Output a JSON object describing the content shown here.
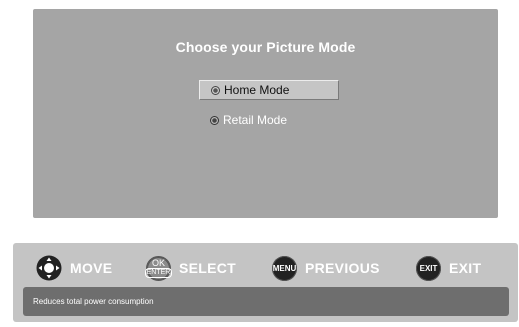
{
  "dialog": {
    "title": "Choose your Picture Mode",
    "options": [
      {
        "label": "Home Mode",
        "selected": true
      },
      {
        "label": "Retail Mode",
        "selected": false
      }
    ]
  },
  "footer": {
    "legend": [
      {
        "icon": "dpad-icon",
        "label": "MOVE"
      },
      {
        "icon": "ok-enter-icon",
        "button_top": "OK",
        "button_bottom": "ENTER",
        "label": "SELECT"
      },
      {
        "icon": "menu-button-icon",
        "button_text": "MENU",
        "label": "PREVIOUS"
      },
      {
        "icon": "exit-button-icon",
        "button_text": "EXIT",
        "label": "EXIT"
      }
    ],
    "help_text": "Reduces total power consumption"
  },
  "colors": {
    "panel": "#a5a5a5",
    "footer": "#c4c4c4",
    "help_bar": "#6e6e6e",
    "selected_option": "#c5c5c5"
  }
}
